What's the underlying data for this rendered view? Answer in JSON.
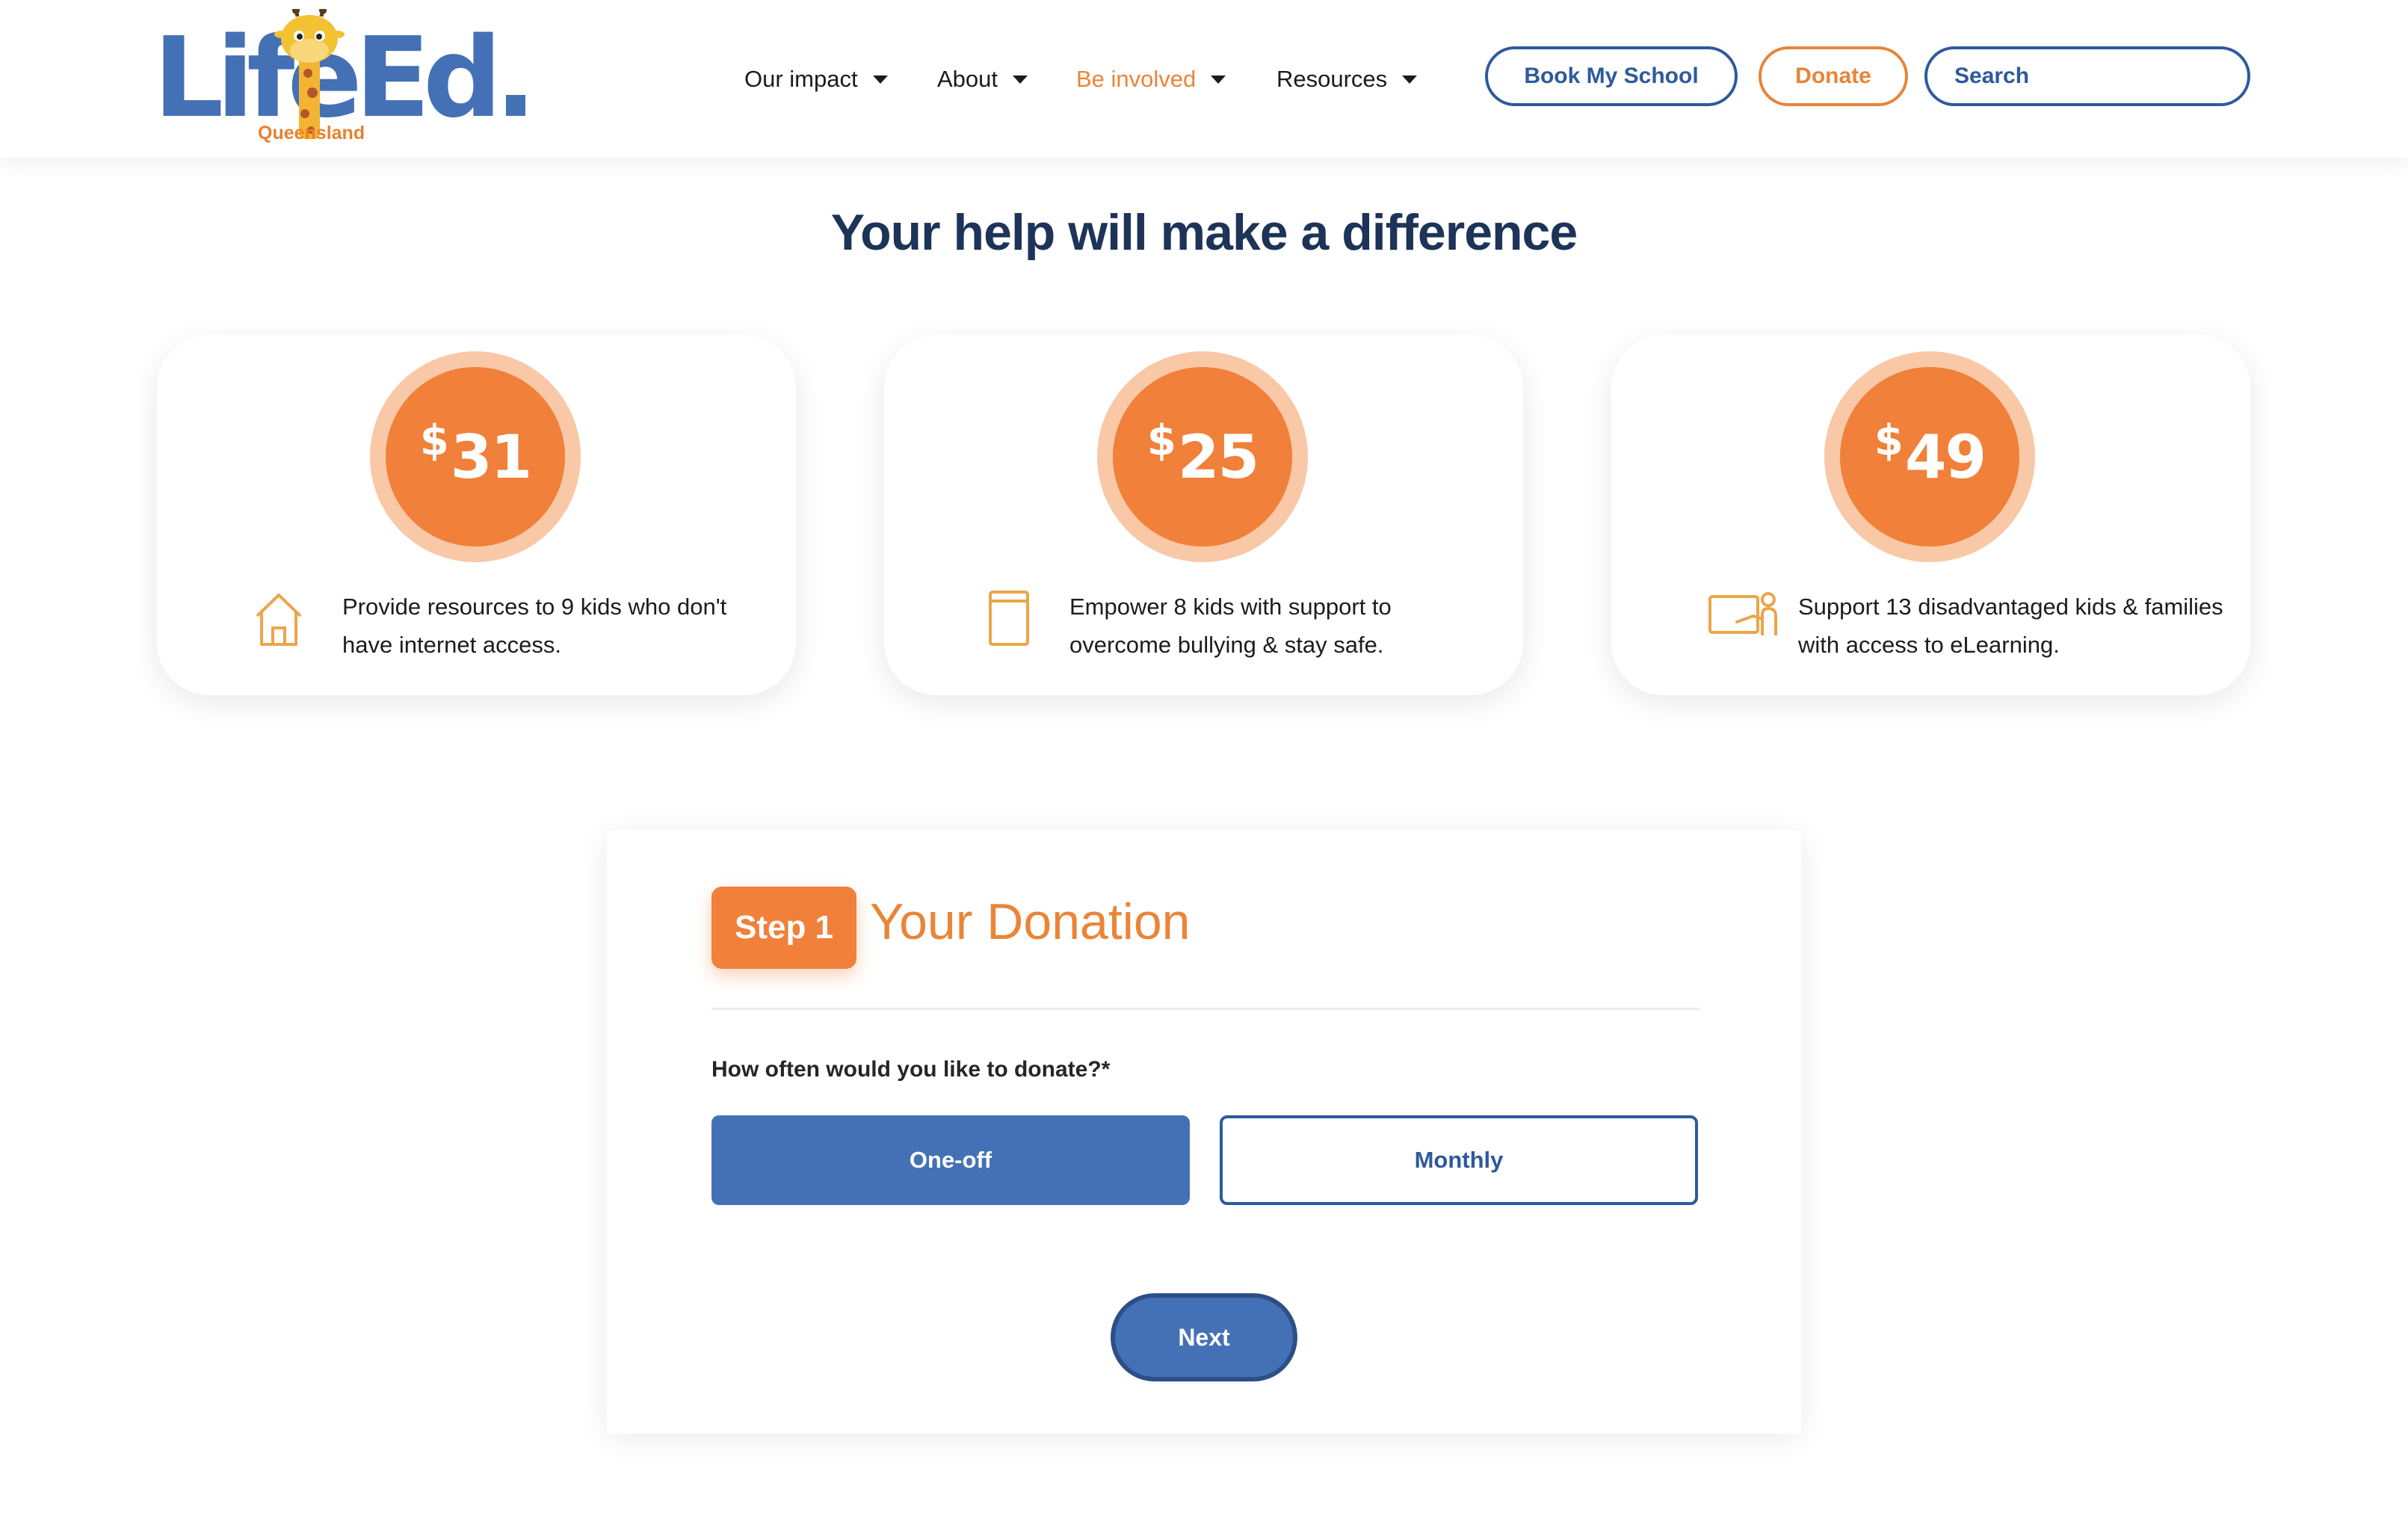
{
  "header": {
    "logo": {
      "main": "LifeEd",
      "dot": ".",
      "region": "Queensland"
    },
    "nav": [
      {
        "label": "Our impact",
        "active": false
      },
      {
        "label": "About",
        "active": false
      },
      {
        "label": "Be involved",
        "active": true
      },
      {
        "label": "Resources",
        "active": false
      }
    ],
    "book_label": "Book My School",
    "donate_label": "Donate",
    "search": {
      "placeholder": "Search"
    }
  },
  "main": {
    "title": "Your help will make a difference",
    "cards": [
      {
        "currency": "$",
        "amount": "31",
        "icon": "house-icon",
        "text": "Provide resources to 9 kids who don't have internet access."
      },
      {
        "currency": "$",
        "amount": "25",
        "icon": "book-icon",
        "text": "Empower 8 kids with support to overcome bullying & stay safe."
      },
      {
        "currency": "$",
        "amount": "49",
        "icon": "teacher-board-icon",
        "text": "Support 13 disadvantaged kids & families with access to eLearning."
      }
    ]
  },
  "form": {
    "step_label": "Step 1",
    "step_title": "Your Donation",
    "question": "How often would you like to donate?*",
    "options": [
      {
        "label": "One-off",
        "selected": true
      },
      {
        "label": "Monthly",
        "selected": false
      }
    ],
    "next_label": "Next"
  },
  "colors": {
    "brand_blue": "#4471b5",
    "navy": "#1d3358",
    "orange": "#f0803a",
    "orange_light": "#f9c8a6",
    "icon_gold": "#eaa64a"
  }
}
